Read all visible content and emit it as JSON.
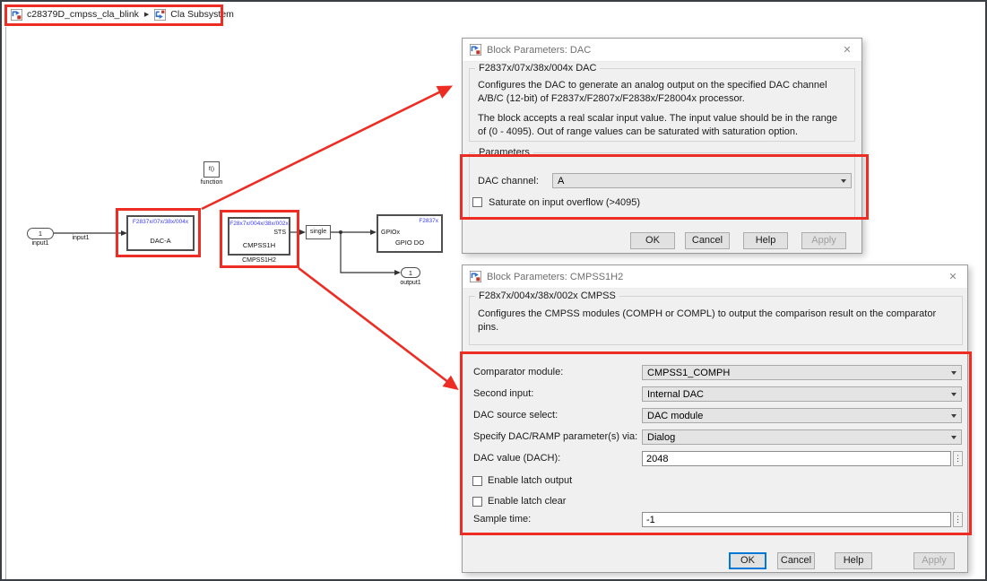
{
  "icons": {
    "breadcrumb_separator": "▶",
    "close": "✕",
    "overflow": "⋮"
  },
  "breadcrumb": {
    "model_label": "c28379D_cmpss_cla_blink",
    "subsystem_label": "Cla Subsystem"
  },
  "diagram": {
    "input_port_number": "1",
    "input_port_label": "input1",
    "signal_label": "input1",
    "function_block_text": "f()",
    "function_block_label": "function",
    "dac_block_chip": "F2837x/07x/38x/004x",
    "dac_block_name": "DAC-A",
    "cmpss_block_chip": "F28x7x/004x/38x/002x",
    "cmpss_block_port": "STS",
    "cmpss_block_name": "CMPSS1H",
    "cmpss_block_label": "CMPSS1H2",
    "single_block_label": "single",
    "gpio_block_chip": "F2837x",
    "gpio_block_port": "GPIOx",
    "gpio_block_name": "GPIO DO",
    "output_port_number": "1",
    "output_port_label": "output1"
  },
  "dac_dialog": {
    "title": "Block Parameters: DAC",
    "section_title": "F2837x/07x/38x/004x DAC",
    "description_1": "Configures the DAC to generate an analog output on the specified DAC channel A/B/C (12-bit) of F2837x/F2807x/F2838x/F28004x processor.",
    "description_2": "The block accepts a real scalar input value. The input value should be in the range of (0 - 4095). Out of range values can be saturated with saturation option.",
    "parameters_label": "Parameters",
    "dac_channel_label": "DAC channel:",
    "dac_channel_value": "A",
    "saturate_checkbox_label": "Saturate on input overflow (>4095)",
    "ok": "OK",
    "cancel": "Cancel",
    "help": "Help",
    "apply": "Apply"
  },
  "cmpss_dialog": {
    "title": "Block Parameters: CMPSS1H2",
    "section_title": "F28x7x/004x/38x/002x CMPSS",
    "description": "Configures the CMPSS modules (COMPH or COMPL) to output the comparison result on the comparator pins.",
    "rows": [
      {
        "label": "Comparator module:",
        "value": "CMPSS1_COMPH"
      },
      {
        "label": "Second input:",
        "value": "Internal DAC"
      },
      {
        "label": "DAC source select:",
        "value": "DAC module"
      },
      {
        "label": "Specify DAC/RAMP parameter(s) via:",
        "value": "Dialog"
      },
      {
        "label": "DAC value (DACH):",
        "value": "2048"
      },
      {
        "label": "Enable latch output"
      },
      {
        "label": "Enable latch clear"
      },
      {
        "label": "Sample time:",
        "value": "-1"
      }
    ],
    "ok": "OK",
    "cancel": "Cancel",
    "help": "Help",
    "apply": "Apply"
  },
  "colors": {
    "annotation_red": "#ed2d24",
    "block_chip_blue": "#3a3aff",
    "ok_focus_blue": "#0078d7"
  }
}
